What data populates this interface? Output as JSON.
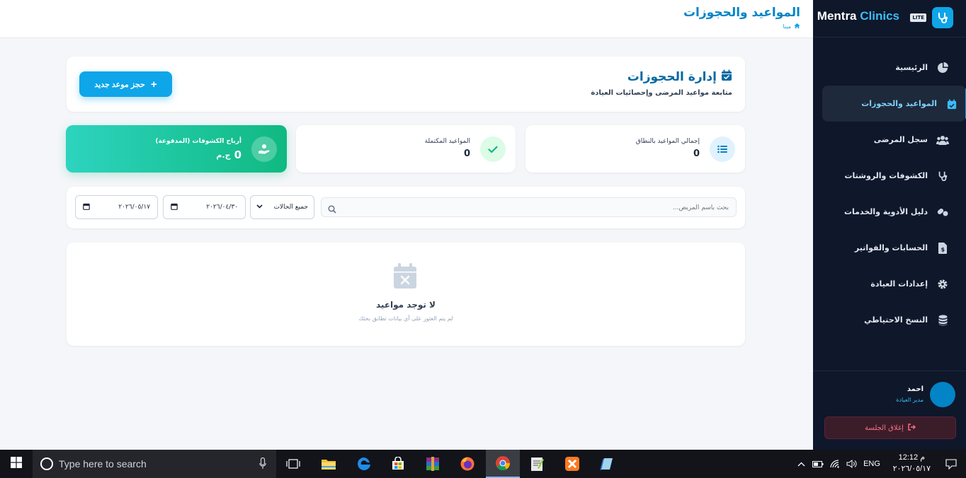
{
  "brand": {
    "name": "Mentra",
    "accent": "Clinics",
    "tag": "LITE"
  },
  "topbar": {
    "title": "المواعيد والحجوزات",
    "breadcrumb": "مينا"
  },
  "sidebar": {
    "items": [
      {
        "label": "الرئيسية",
        "icon": "pie-chart-icon"
      },
      {
        "label": "المواعيد والحجوزات",
        "icon": "calendar-check-icon",
        "active": true
      },
      {
        "label": "سجل المرضى",
        "icon": "users-icon"
      },
      {
        "label": "الكشوفات والروشتات",
        "icon": "stethoscope-icon"
      },
      {
        "label": "دليل الأدوية والخدمات",
        "icon": "pills-icon"
      },
      {
        "label": "الحسابات والفواتير",
        "icon": "invoice-icon"
      },
      {
        "label": "إعدادات العيادة",
        "icon": "gear-icon"
      },
      {
        "label": "النسخ الاحتياطي",
        "icon": "database-icon"
      }
    ],
    "user": {
      "name": "احمد",
      "role": "مدير العيادة"
    },
    "logout_label": "إغلاق الجلسة"
  },
  "header": {
    "title": "إدارة الحجوزات",
    "subtitle": "متابعة مواعيد المرضى وإحصائيات العيادة",
    "new_button": "حجز موعد جديد"
  },
  "stats": [
    {
      "label": "إجمالي المواعيد بالنطاق",
      "value": "0"
    },
    {
      "label": "المواعيد المكتملة",
      "value": "0"
    },
    {
      "label": "أرباح الكشوفات (المدفوعة)",
      "value": "0",
      "unit": "ج.م"
    }
  ],
  "filters": {
    "search_placeholder": "بحث باسم المريض...",
    "status_selected": "جميع الحالات",
    "date_from": "٢٠٢٦/٠٤/٣٠",
    "date_to": "٢٠٢٦/٠٥/١٧"
  },
  "empty": {
    "title": "لا توجد مواعيد",
    "subtitle": "لم يتم العثور على أي بيانات تطابق بحثك"
  },
  "taskbar": {
    "search_placeholder": "Type here to search",
    "lang": "ENG",
    "time": "12:12 م",
    "date": "٢٠٢٦/٠٥/١٧"
  },
  "colors": {
    "accent": "#0ea5e9",
    "sidebar": "#0f172a",
    "success": "#10b981",
    "danger": "#fb7185"
  }
}
